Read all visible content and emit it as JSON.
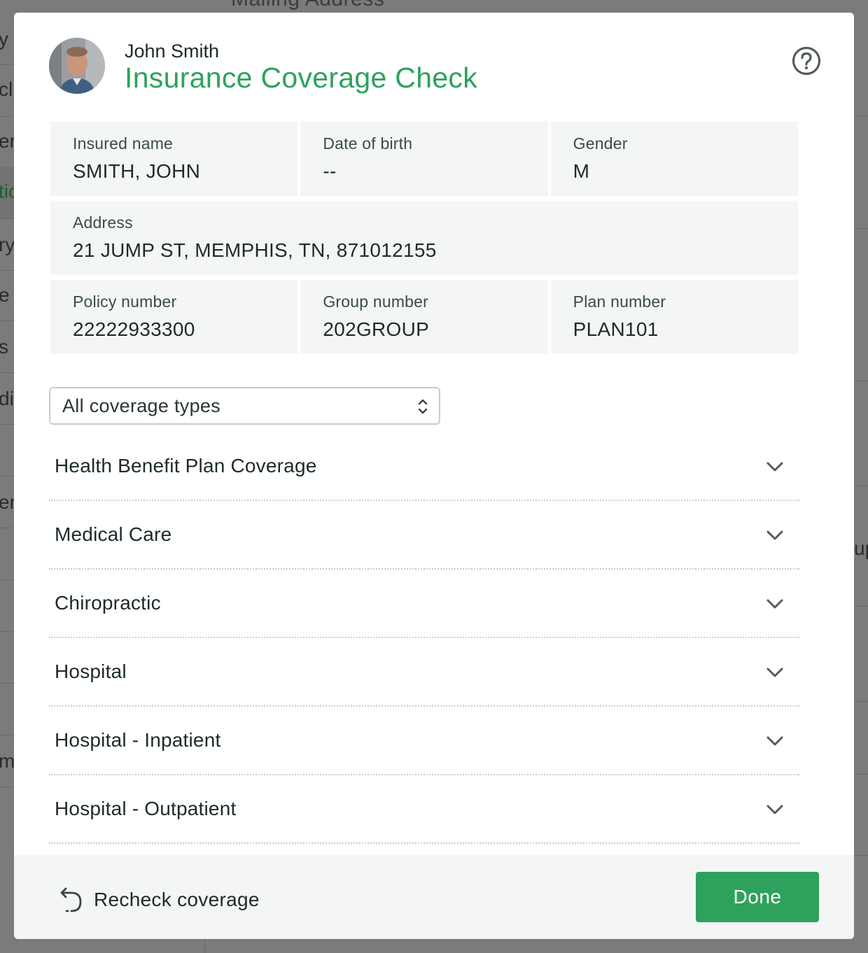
{
  "background": {
    "top_title": "Mailing Address",
    "left_fragments": [
      "y",
      "cl",
      "er",
      "tio",
      "ry",
      "e",
      "s &",
      "di",
      "ers",
      "m"
    ],
    "right_fragments": [
      "up"
    ]
  },
  "patient": {
    "name": "John Smith",
    "avatar_icon": "patient-avatar"
  },
  "modal": {
    "title": "Insurance Coverage Check",
    "help_icon": "question-circle-icon",
    "accent_color": "#2ea25c"
  },
  "insured": {
    "name_label": "Insured name",
    "name_value": "SMITH, JOHN",
    "dob_label": "Date of birth",
    "dob_value": "--",
    "gender_label": "Gender",
    "gender_value": "M",
    "address_label": "Address",
    "address_value": "21 JUMP ST, MEMPHIS, TN, 871012155",
    "policy_label": "Policy number",
    "policy_value": "22222933300",
    "group_label": "Group number",
    "group_value": "202GROUP",
    "plan_label": "Plan number",
    "plan_value": "PLAN101"
  },
  "coverage_filter": {
    "selected": "All coverage types"
  },
  "coverage_types": [
    "Health Benefit Plan Coverage",
    "Medical Care",
    "Chiropractic",
    "Hospital",
    "Hospital - Inpatient",
    "Hospital - Outpatient"
  ],
  "footer": {
    "recheck_label": "Recheck coverage",
    "done_label": "Done"
  }
}
